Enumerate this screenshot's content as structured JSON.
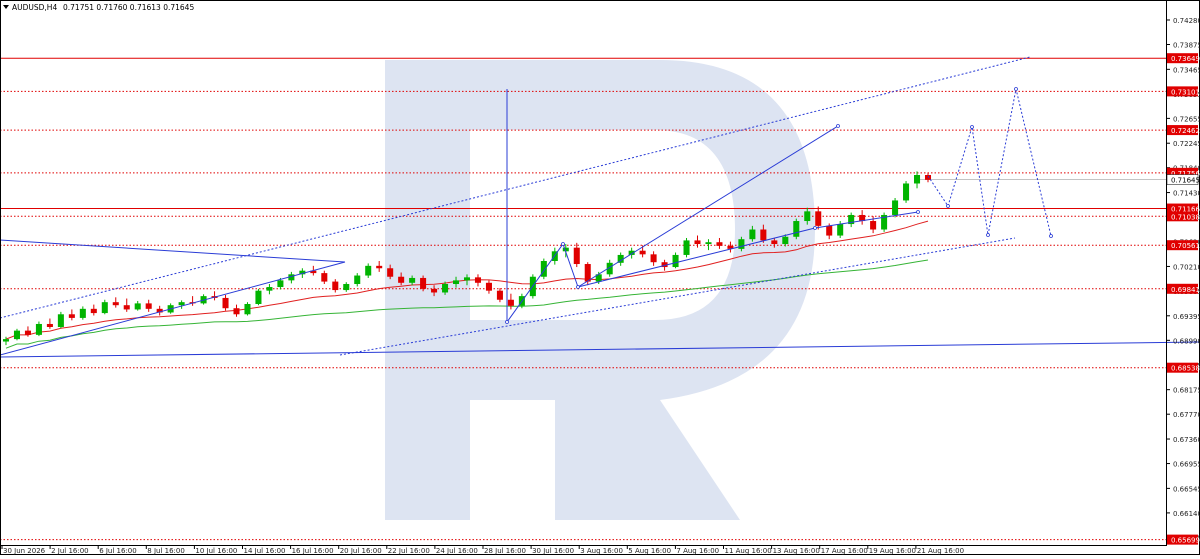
{
  "header": {
    "symbol": "AUDUSD,H4",
    "ohlc": "0.71751 0.71760 0.71613 0.71645"
  },
  "colors": {
    "bull": "#00b400",
    "bear": "#e00000",
    "level": "#e00000",
    "forecast": "#2a3cd6",
    "ma_red": "#e02020",
    "ma_green": "#36b436",
    "watermark": "#dde4f2",
    "axis_text": "#222222"
  },
  "chart_data": {
    "type": "candlestick",
    "x_tick_labels": [
      "30 Jun 2026",
      "2 Jul 16:00",
      "6 Jul 16:00",
      "8 Jul 16:00",
      "10 Jul 16:00",
      "14 Jul 16:00",
      "16 Jul 16:00",
      "20 Jul 16:00",
      "22 Jul 16:00",
      "24 Jul 16:00",
      "28 Jul 16:00",
      "30 Jul 16:00",
      "3 Aug 16:00",
      "5 Aug 16:00",
      "7 Aug 16:00",
      "11 Aug 16:00",
      "13 Aug 16:00",
      "17 Aug 16:00",
      "19 Aug 16:00",
      "21 Aug 16:00"
    ],
    "y_ticks": [
      "0.74280",
      "0.73875",
      "0.73465",
      "0.73055",
      "0.72655",
      "0.72245",
      "0.71840",
      "0.71430",
      "0.71025",
      "0.70620",
      "0.70210",
      "0.69805",
      "0.69395",
      "0.68990",
      "0.68585",
      "0.68175",
      "0.67770",
      "0.67360",
      "0.66955",
      "0.66545",
      "0.66140",
      "0.65735"
    ],
    "y_range": [
      0.6561,
      0.7461
    ],
    "levels": [
      {
        "value": "0.73649",
        "style": "solid"
      },
      {
        "value": "0.73101",
        "style": "dotted"
      },
      {
        "value": "0.72462",
        "style": "dotted"
      },
      {
        "value": "0.71756",
        "style": "dotted"
      },
      {
        "value": "0.71166",
        "style": "solid"
      },
      {
        "value": "0.71038",
        "style": "dotted"
      },
      {
        "value": "0.70561",
        "style": "dotted"
      },
      {
        "value": "0.69841",
        "style": "dotted"
      },
      {
        "value": "0.68538",
        "style": "dotted"
      },
      {
        "value": "0.65699",
        "style": "dotted"
      }
    ],
    "current_price": "0.71645",
    "candles": [
      [
        0.6897,
        0.6905,
        0.6891,
        0.6901
      ],
      [
        0.6901,
        0.6918,
        0.6899,
        0.6915
      ],
      [
        0.6915,
        0.6922,
        0.6905,
        0.6908
      ],
      [
        0.6908,
        0.693,
        0.6906,
        0.6926
      ],
      [
        0.6926,
        0.6935,
        0.6918,
        0.6921
      ],
      [
        0.6921,
        0.6946,
        0.6919,
        0.6942
      ],
      [
        0.6942,
        0.695,
        0.6932,
        0.6936
      ],
      [
        0.6936,
        0.6955,
        0.6933,
        0.6951
      ],
      [
        0.6951,
        0.6958,
        0.694,
        0.6944
      ],
      [
        0.6944,
        0.6966,
        0.6942,
        0.6962
      ],
      [
        0.6962,
        0.697,
        0.6953,
        0.6957
      ],
      [
        0.6957,
        0.6968,
        0.6946,
        0.695
      ],
      [
        0.695,
        0.6964,
        0.6948,
        0.696
      ],
      [
        0.696,
        0.6966,
        0.6946,
        0.6951
      ],
      [
        0.6951,
        0.6956,
        0.694,
        0.6945
      ],
      [
        0.6945,
        0.696,
        0.6943,
        0.6957
      ],
      [
        0.6957,
        0.6965,
        0.6951,
        0.6962
      ],
      [
        0.6962,
        0.6972,
        0.6956,
        0.696
      ],
      [
        0.696,
        0.6975,
        0.6958,
        0.6972
      ],
      [
        0.6972,
        0.698,
        0.6965,
        0.6969
      ],
      [
        0.6969,
        0.6974,
        0.6948,
        0.6952
      ],
      [
        0.6952,
        0.6958,
        0.6938,
        0.6942
      ],
      [
        0.6942,
        0.6962,
        0.694,
        0.6959
      ],
      [
        0.6959,
        0.6984,
        0.6957,
        0.6981
      ],
      [
        0.6981,
        0.6992,
        0.6975,
        0.6987
      ],
      [
        0.6987,
        0.7002,
        0.6983,
        0.6998
      ],
      [
        0.6998,
        0.7012,
        0.6993,
        0.7008
      ],
      [
        0.7008,
        0.7018,
        0.7002,
        0.7014
      ],
      [
        0.7014,
        0.7022,
        0.7006,
        0.701
      ],
      [
        0.701,
        0.7014,
        0.6992,
        0.6996
      ],
      [
        0.6996,
        0.7,
        0.6978,
        0.6982
      ],
      [
        0.6982,
        0.6995,
        0.6979,
        0.6992
      ],
      [
        0.6992,
        0.701,
        0.6988,
        0.7006
      ],
      [
        0.7006,
        0.7026,
        0.7002,
        0.7022
      ],
      [
        0.7022,
        0.703,
        0.7012,
        0.7018
      ],
      [
        0.7018,
        0.7024,
        0.7,
        0.7004
      ],
      [
        0.7004,
        0.7011,
        0.699,
        0.6994
      ],
      [
        0.6994,
        0.7006,
        0.699,
        0.7002
      ],
      [
        0.7002,
        0.7006,
        0.698,
        0.6984
      ],
      [
        0.6984,
        0.699,
        0.6972,
        0.6978
      ],
      [
        0.6978,
        0.6996,
        0.6974,
        0.6992
      ],
      [
        0.6992,
        0.7004,
        0.6986,
        0.6998
      ],
      [
        0.6998,
        0.7008,
        0.699,
        0.7003
      ],
      [
        0.7003,
        0.7008,
        0.6988,
        0.6994
      ],
      [
        0.6994,
        0.6998,
        0.6976,
        0.6981
      ],
      [
        0.6981,
        0.6985,
        0.6962,
        0.6966
      ],
      [
        0.6966,
        0.6976,
        0.695,
        0.6956
      ],
      [
        0.6956,
        0.6976,
        0.6952,
        0.6972
      ],
      [
        0.6972,
        0.7008,
        0.6968,
        0.7004
      ],
      [
        0.7004,
        0.7034,
        0.7,
        0.703
      ],
      [
        0.703,
        0.7052,
        0.7024,
        0.7046
      ],
      [
        0.7046,
        0.7058,
        0.7036,
        0.7052
      ],
      [
        0.7052,
        0.706,
        0.702,
        0.7025
      ],
      [
        0.7025,
        0.7028,
        0.699,
        0.6996
      ],
      [
        0.6996,
        0.7012,
        0.6992,
        0.7008
      ],
      [
        0.7008,
        0.7032,
        0.7004,
        0.7027
      ],
      [
        0.7027,
        0.7044,
        0.7022,
        0.704
      ],
      [
        0.704,
        0.7052,
        0.7034,
        0.7047
      ],
      [
        0.7047,
        0.7056,
        0.7036,
        0.7041
      ],
      [
        0.7041,
        0.7046,
        0.7022,
        0.7028
      ],
      [
        0.7028,
        0.7032,
        0.7014,
        0.702
      ],
      [
        0.702,
        0.7044,
        0.7018,
        0.704
      ],
      [
        0.704,
        0.7068,
        0.7036,
        0.7064
      ],
      [
        0.7064,
        0.7072,
        0.7052,
        0.7058
      ],
      [
        0.7058,
        0.7066,
        0.7048,
        0.7061
      ],
      [
        0.7061,
        0.7068,
        0.705,
        0.7055
      ],
      [
        0.7055,
        0.7062,
        0.7044,
        0.705
      ],
      [
        0.705,
        0.707,
        0.7046,
        0.7066
      ],
      [
        0.7066,
        0.7088,
        0.7062,
        0.7082
      ],
      [
        0.7082,
        0.709,
        0.706,
        0.7064
      ],
      [
        0.7064,
        0.7068,
        0.7052,
        0.7058
      ],
      [
        0.7058,
        0.7074,
        0.7054,
        0.707
      ],
      [
        0.707,
        0.71,
        0.7066,
        0.7096
      ],
      [
        0.7096,
        0.7118,
        0.709,
        0.7112
      ],
      [
        0.7112,
        0.712,
        0.7082,
        0.7088
      ],
      [
        0.7088,
        0.7092,
        0.7066,
        0.7072
      ],
      [
        0.7072,
        0.7096,
        0.7068,
        0.7091
      ],
      [
        0.7091,
        0.711,
        0.7086,
        0.7106
      ],
      [
        0.7106,
        0.7114,
        0.709,
        0.7096
      ],
      [
        0.7096,
        0.7104,
        0.7076,
        0.7082
      ],
      [
        0.7082,
        0.711,
        0.7078,
        0.7106
      ],
      [
        0.7106,
        0.7134,
        0.7102,
        0.713
      ],
      [
        0.713,
        0.7162,
        0.7126,
        0.7158
      ],
      [
        0.7158,
        0.7178,
        0.715,
        0.7172
      ],
      [
        0.7172,
        0.7176,
        0.716,
        0.7164
      ]
    ]
  }
}
